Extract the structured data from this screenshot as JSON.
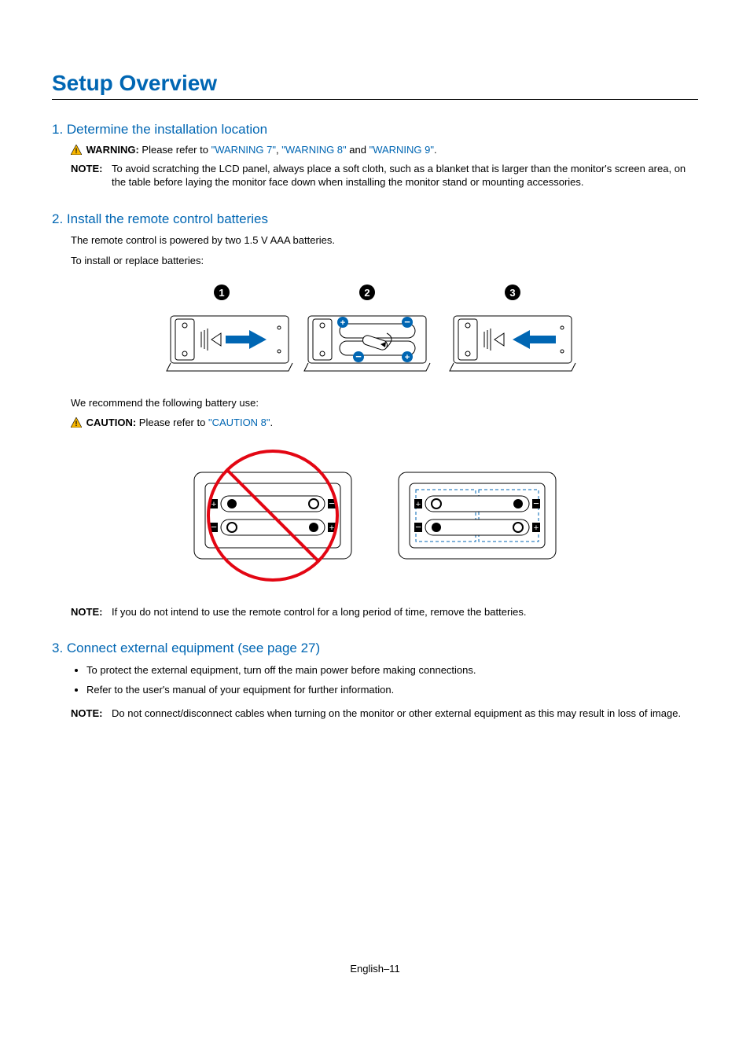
{
  "title": "Setup Overview",
  "footer": "English–11",
  "sections": {
    "s1": {
      "heading": "1. Determine the installation location",
      "warning_label": "WARNING:",
      "warning_text_pre": "  Please refer to ",
      "warning_links": {
        "a": "\"WARNING 7\"",
        "b": "\"WARNING 8\"",
        "c": "\"WARNING 9\""
      },
      "warning_sep1": ", ",
      "warning_sep2": " and ",
      "warning_tail": ".",
      "note_label": "NOTE:",
      "note_text": "To avoid scratching the LCD panel, always place a soft cloth, such as a blanket that is larger than the monitor's screen area, on the table before laying the monitor face down when installing the monitor stand or mounting accessories."
    },
    "s2": {
      "heading": "2. Install the remote control batteries",
      "p1": "The remote control is powered by two 1.5 V AAA batteries.",
      "p2": "To install or replace batteries:",
      "p3": "We recommend the following battery use:",
      "caution_label": "CAUTION:",
      "caution_text_pre": "  Please refer to ",
      "caution_link": "\"CAUTION 8\"",
      "caution_tail": ".",
      "note_label": "NOTE:",
      "note_text": "If you do not intend to use the remote control for a long period of time, remove the batteries."
    },
    "s3": {
      "heading": "3. Connect external equipment (see page 27)",
      "b1": "To protect the external equipment, turn off the main power before making connections.",
      "b2": "Refer to the user's manual of your equipment for further information.",
      "note_label": "NOTE:",
      "note_text": "Do not connect/disconnect cables when turning on the monitor or other external equipment as this may result in loss of image."
    }
  }
}
